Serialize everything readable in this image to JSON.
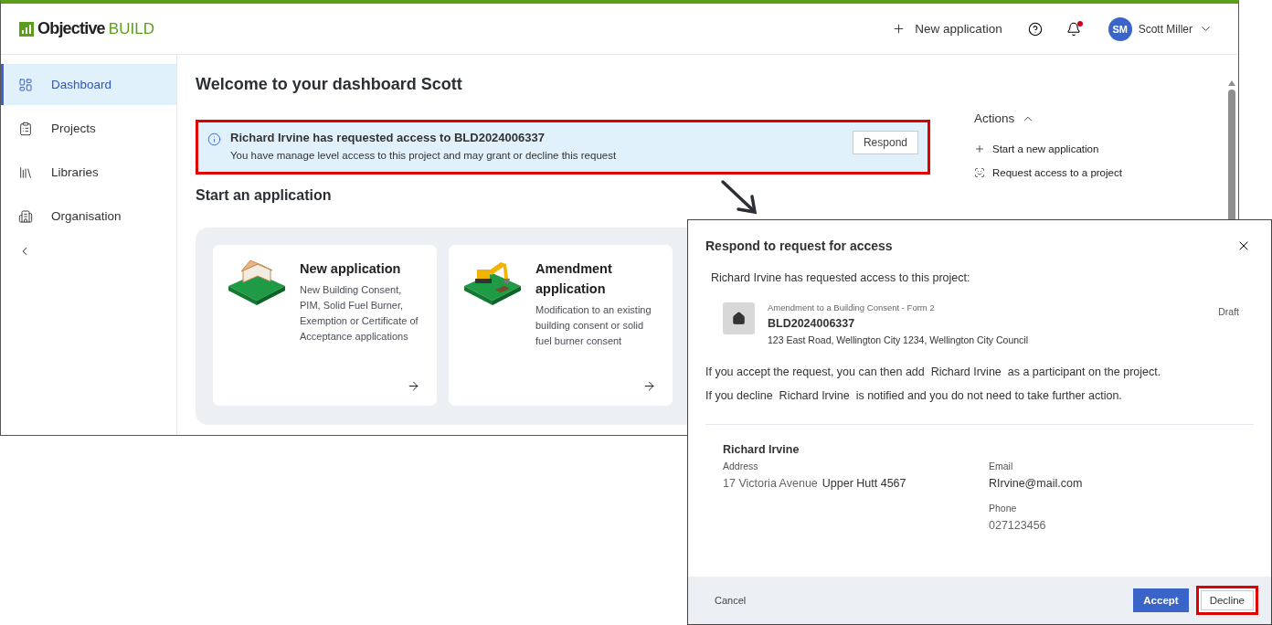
{
  "header": {
    "logo": {
      "name": "Objective",
      "product": "BUILD"
    },
    "new_application": "New application",
    "notifications": {
      "unread": true
    },
    "user": {
      "initials": "SM",
      "name": "Scott Miller"
    }
  },
  "sidebar": {
    "items": [
      {
        "label": "Dashboard",
        "selected": true
      },
      {
        "label": "Projects",
        "selected": false
      },
      {
        "label": "Libraries",
        "selected": false
      },
      {
        "label": "Organisation",
        "selected": false
      }
    ]
  },
  "page_title": "Welcome to your dashboard Scott",
  "banner": {
    "title": "Richard Irvine has requested access to BLD2024006337",
    "text": "You have manage level access to this project and may grant or decline this request",
    "button": "Respond",
    "highlighted": true
  },
  "start_section": {
    "title": "Start an application",
    "cards": [
      {
        "kind": "house",
        "title": "New application",
        "text": "New Building Consent, PIM, Solid Fuel Burner, Exemption or Certificate of Acceptance applications"
      },
      {
        "kind": "excavator",
        "title": "Amendment application",
        "text": "Modification to an existing building consent or solid fuel burner consent"
      }
    ]
  },
  "actions": {
    "title": "Actions",
    "expanded": true,
    "items": [
      {
        "label": "Start a new application"
      },
      {
        "label": "Request access to a project"
      }
    ]
  },
  "dialog": {
    "title": "Respond to request for access",
    "intro": "Richard Irvine has requested access to this project:",
    "project": {
      "form": "Amendment to a Building Consent - Form 2",
      "number": "BLD2024006337",
      "address": "123 East Road, Wellington City 1234, Wellington City Council",
      "status": "Draft"
    },
    "accept_note": "If you accept the request, you can then add  Richard Irvine  as a participant on the project.",
    "decline_note": "If you decline  Richard Irvine  is notified and you do not need to take further action.",
    "requester": {
      "name": "Richard Irvine",
      "address_label": "Address",
      "street": "17 Victoria Avenue",
      "town": "Upper Hutt 4567",
      "email_label": "Email",
      "email": "RIrvine@mail.com",
      "phone_label": "Phone",
      "phone": "027123456"
    },
    "cancel": "Cancel",
    "accept": "Accept",
    "decline": {
      "label": "Decline",
      "highlighted": true
    }
  }
}
